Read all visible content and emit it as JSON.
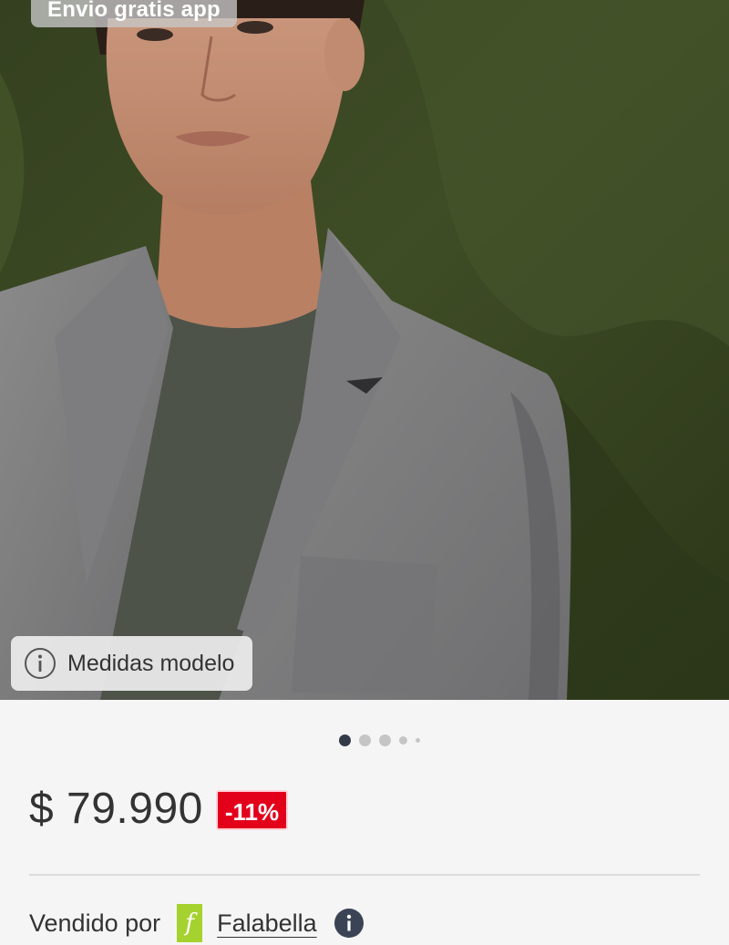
{
  "product": {
    "shipping_badge": "Envio gratis app",
    "model_measures_label": "Medidas modelo",
    "image_count": 5,
    "active_image": 1,
    "price": "$ 79.990",
    "discount_badge": "-11%"
  },
  "seller": {
    "prefix": "Vendido por",
    "logo_letter": "f",
    "name": "Falabella"
  },
  "icons": {
    "info": "info-circle-icon",
    "seller_info": "info-filled-icon"
  },
  "colors": {
    "discount_bg": "#e3001b",
    "falabella_green": "#a6d22f",
    "active_dot": "#333a48"
  }
}
